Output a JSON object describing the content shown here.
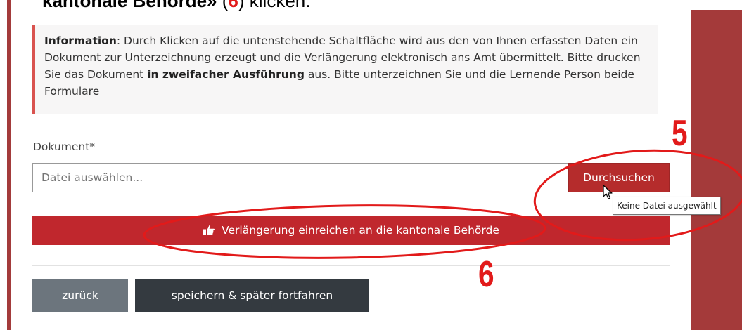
{
  "instruction": {
    "title": "kantonale Behörde»",
    "paren_open": " (",
    "step": "6",
    "paren_close": ") ",
    "verb": "klicken."
  },
  "info_box": {
    "label": "Information",
    "text_before": ": Durch Klicken auf die untenstehende Schaltfläche wird aus den von Ihnen erfassten Daten ein Dokument zur Unterzeichnung erzeugt und die Verlängerung elektronisch ans Amt übermittelt. Bitte drucken Sie das Dokument ",
    "emphasis": "in zweifacher Ausführung",
    "text_after": " aus. Bitte unterzeichnen Sie und die Lernende Person beide Formulare"
  },
  "document_field": {
    "label": "Dokument*",
    "placeholder": "Datei auswählen...",
    "browse_label": "Durchsuchen",
    "tooltip": "Keine Datei ausgewählt"
  },
  "submit": {
    "label": "Verlängerung einreichen an die kantonale Behörde",
    "icon": "hand-pointing-right-icon"
  },
  "actions": {
    "back_label": "zurück",
    "save_label": "speichern & später fortfahren"
  },
  "annotations": {
    "step5": "5",
    "step6": "6"
  },
  "colors": {
    "accent_red": "#c0272d",
    "annotation_red": "#e21a1a",
    "side_panel": "#a43a3a",
    "back_button": "#6c757d",
    "save_button": "#343a40"
  }
}
